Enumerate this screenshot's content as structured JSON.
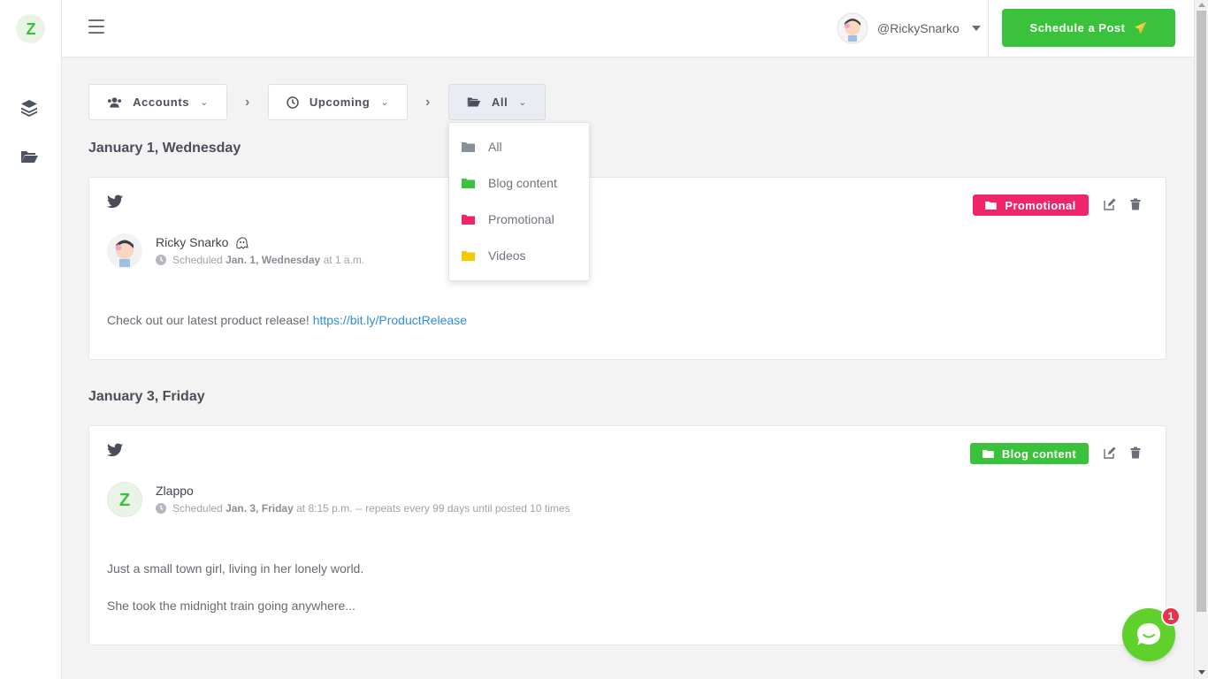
{
  "app": {
    "user_handle": "@RickySnarko",
    "schedule_button": "Schedule a Post",
    "brand_color": "#3ac23c"
  },
  "sidebar": {
    "items": [
      {
        "icon": "layers-icon"
      },
      {
        "icon": "folder-open-icon"
      }
    ]
  },
  "filters": {
    "accounts": "Accounts",
    "time": "Upcoming",
    "category": "All"
  },
  "category_menu": {
    "items": [
      {
        "label": "All",
        "color": "#8a8f9c"
      },
      {
        "label": "Blog content",
        "color": "#3ac23c"
      },
      {
        "label": "Promotional",
        "color": "#f0246a"
      },
      {
        "label": "Videos",
        "color": "#f5c800"
      }
    ]
  },
  "posts": [
    {
      "date_heading": "January 1, Wednesday",
      "author": "Ricky Snarko",
      "scheduled_prefix": "Scheduled",
      "scheduled_date": "Jan. 1, Wednesday",
      "scheduled_suffix": "at 1 a.m.",
      "body_text": "Check out our latest product release!",
      "body_link": "https://bit.ly/ProductRelease",
      "tag": "Promotional",
      "tag_color": "#f0246a"
    },
    {
      "date_heading": "January 3, Friday",
      "author": "Zlappo",
      "scheduled_prefix": "Scheduled",
      "scheduled_date": "Jan. 3, Friday",
      "scheduled_suffix": "at 8:15 p.m. -- repeats every 99 days until posted 10 times",
      "body_line1": "Just a small town girl, living in her lonely world.",
      "body_line2": "She took the midnight train going anywhere...",
      "tag": "Blog content",
      "tag_color": "#3ac23c"
    }
  ],
  "chat": {
    "badge_count": "1"
  }
}
